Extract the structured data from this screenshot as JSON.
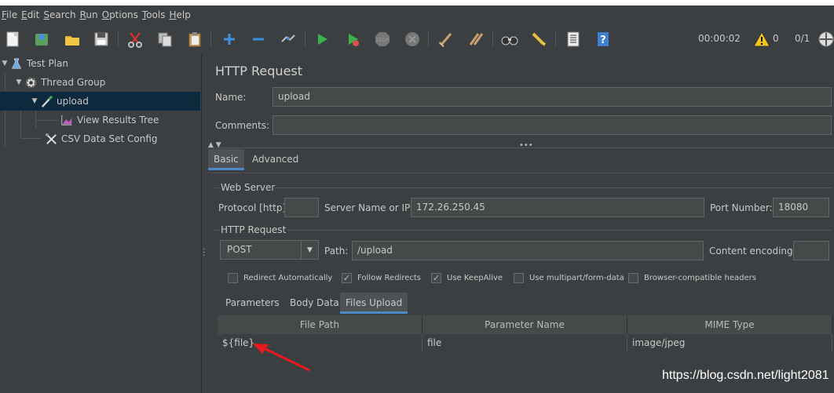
{
  "menu": [
    {
      "accel": "F",
      "rest": "ile"
    },
    {
      "accel": "E",
      "rest": "dit"
    },
    {
      "accel": "S",
      "rest": "earch"
    },
    {
      "accel": "R",
      "rest": "un"
    },
    {
      "accel": "O",
      "rest": "ptions"
    },
    {
      "accel": "T",
      "rest": "ools"
    },
    {
      "accel": "H",
      "rest": "elp"
    }
  ],
  "toolbar": {
    "timer": "00:00:02",
    "warnings": "0",
    "threads": "0/1"
  },
  "tree": {
    "test_plan": "Test Plan",
    "thread_group": "Thread Group",
    "upload": "upload",
    "view_results_tree": "View Results Tree",
    "csv_data_set_config": "CSV Data Set Config"
  },
  "panel": {
    "title": "HTTP Request",
    "name_label": "Name:",
    "name_value": "upload",
    "comments_label": "Comments:",
    "comments_value": "",
    "tabs": [
      "Basic",
      "Advanced"
    ],
    "web_server": {
      "group_label": "Web Server",
      "protocol_label": "Protocol [http]:",
      "protocol_value": "",
      "server_label": "Server Name or IP:",
      "server_value": "172.26.250.45",
      "port_label": "Port Number:",
      "port_value": "18080"
    },
    "http_request": {
      "group_label": "HTTP Request",
      "method": "POST",
      "path_label": "Path:",
      "path_value": "/upload",
      "encoding_label": "Content encoding:",
      "encoding_value": ""
    },
    "options": [
      {
        "label": "Redirect Automatically",
        "checked": false
      },
      {
        "label": "Follow Redirects",
        "checked": true
      },
      {
        "label": "Use KeepAlive",
        "checked": true
      },
      {
        "label": "Use multipart/form-data",
        "checked": false
      },
      {
        "label": "Browser-compatible headers",
        "checked": false
      }
    ],
    "subtabs": [
      "Parameters",
      "Body Data",
      "Files Upload"
    ],
    "files_table": {
      "headers": [
        "File Path",
        "Parameter Name",
        "MIME Type"
      ],
      "rows": [
        {
          "file_path": "${file}",
          "parameter_name": "file",
          "mime_type": "image/jpeg"
        }
      ]
    }
  },
  "watermark": "https://blog.csdn.net/light2081",
  "colors": {
    "background": "#3c3f41",
    "selection": "#0d293e",
    "accent": "#4a88c7",
    "arrow": "#e8191c"
  }
}
